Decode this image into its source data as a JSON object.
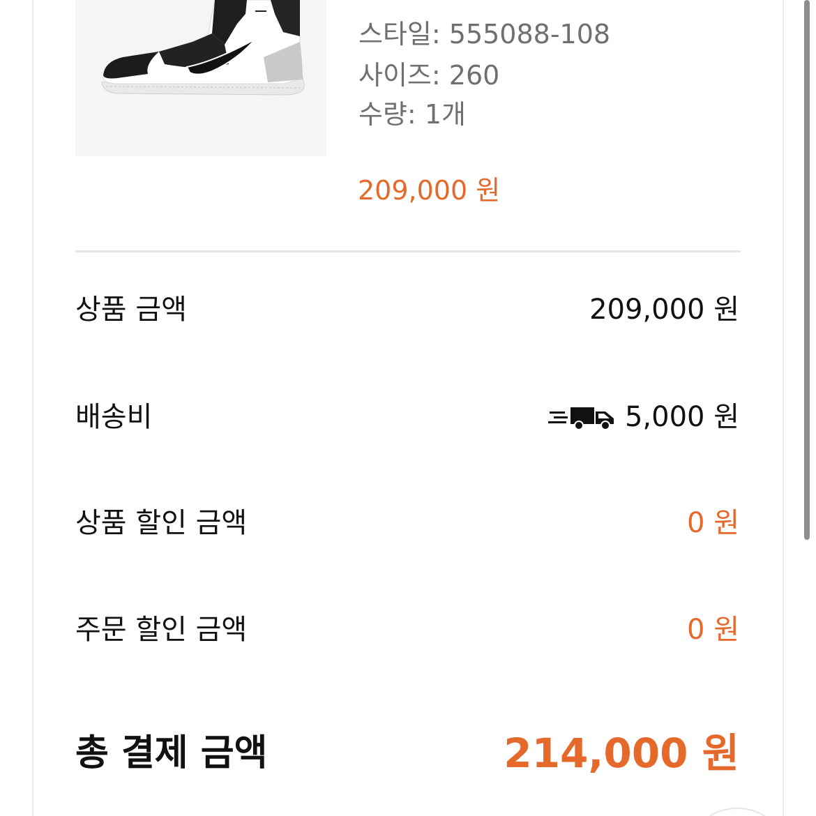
{
  "product": {
    "image_alt": "sneaker",
    "style_label": "스타일:",
    "style_value": "555088-108",
    "size_label": "사이즈:",
    "size_value": "260",
    "qty_label": "수량:",
    "qty_value": "1개",
    "price": "209,000 원"
  },
  "summary": {
    "product_amount_label": "상품 금액",
    "product_amount_value": "209,000 원",
    "shipping_label": "배송비",
    "shipping_value": "5,000 원",
    "shipping_icon": "delivery-truck-icon",
    "product_discount_label": "상품 할인 금액",
    "product_discount_value": "0 원",
    "order_discount_label": "주문 할인 금액",
    "order_discount_value": "0 원",
    "total_label": "총 결제 금액",
    "total_value": "214,000 원"
  },
  "colors": {
    "accent": "#e6692c",
    "text_primary": "#111111",
    "text_secondary": "#6f6f6f",
    "divider": "#e5e5e5",
    "image_bg": "#f5f5f5"
  }
}
